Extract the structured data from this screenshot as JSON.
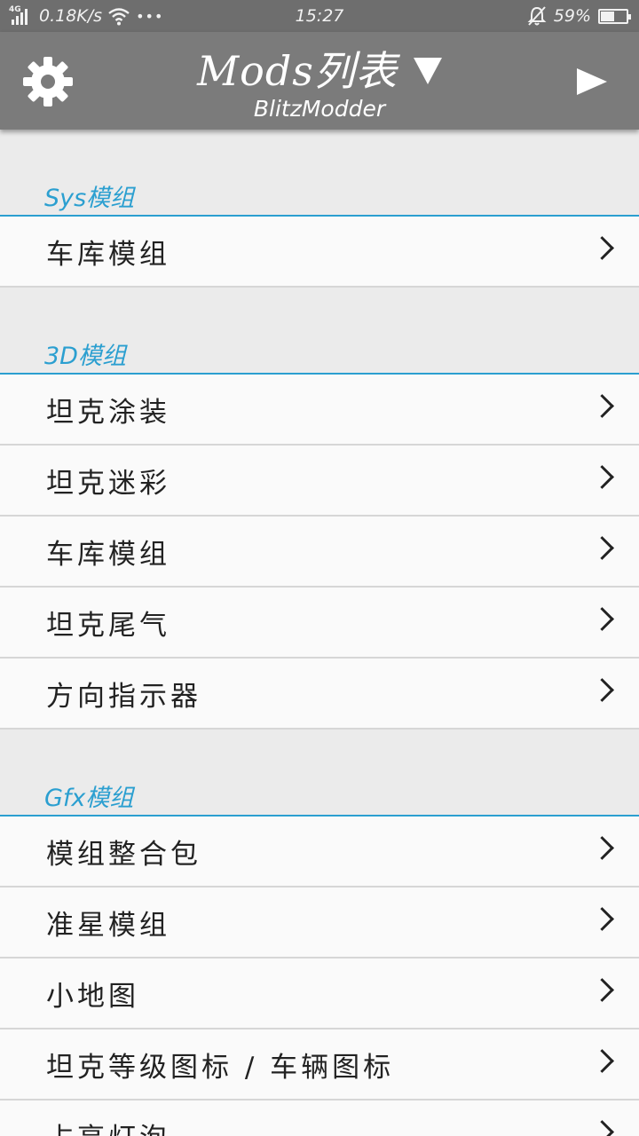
{
  "status_bar": {
    "network_type": "4G",
    "speed": "0.18K/s",
    "more": "•••",
    "time": "15:27",
    "battery_percent_text": "59%",
    "battery_level": 0.59
  },
  "app_bar": {
    "title": "Mods列表",
    "subtitle": "BlitzModder",
    "settings_icon": "gear-icon",
    "dropdown_icon": "triangle-down-icon",
    "play_icon": "play-icon"
  },
  "sections": [
    {
      "label": "Sys模组",
      "items": [
        "车库模组"
      ]
    },
    {
      "label": "3D模组",
      "items": [
        "坦克涂装",
        "坦克迷彩",
        "车库模组",
        "坦克尾气",
        "方向指示器"
      ]
    },
    {
      "label": "Gfx模组",
      "items": [
        "模组整合包",
        "准星模组",
        "小地图",
        "坦克等级图标 / 车辆图标",
        "占亮灯泡"
      ]
    }
  ],
  "colors": {
    "accent": "#2b9fd0",
    "app_bar": "#7b7b7b",
    "status_bar": "#6e6e6e",
    "background": "#ebebeb"
  }
}
